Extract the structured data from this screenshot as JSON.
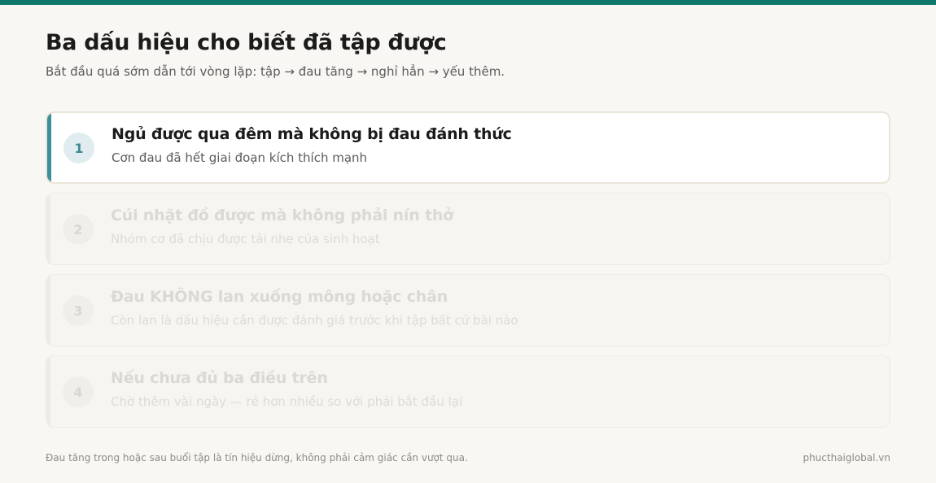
{
  "header": {
    "title": "Ba dấu hiệu cho biết đã tập được",
    "subtitle": "Bắt đầu quá sớm dẫn tới vòng lặp: tập → đau tăng → nghỉ hẳn → yếu thêm."
  },
  "steps": [
    {
      "number": "1",
      "title": "Ngủ được qua đêm mà không bị đau đánh thức",
      "description": "Cơn đau đã hết giai đoạn kích thích mạnh",
      "active": true
    },
    {
      "number": "2",
      "title": "Cúi nhặt đồ được mà không phải nín thở",
      "description": "Nhóm cơ đã chịu được tải nhẹ của sinh hoạt",
      "active": false
    },
    {
      "number": "3",
      "title": "Đau KHÔNG lan xuống mông hoặc chân",
      "description": "Còn lan là dấu hiệu cần được đánh giá trước khi tập bất cứ bài nào",
      "active": false
    },
    {
      "number": "4",
      "title": "Nếu chưa đủ ba điều trên",
      "description": "Chờ thêm vài ngày — rẻ hơn nhiều so với phải bắt đầu lại",
      "active": false
    }
  ],
  "footer": {
    "note": "Đau tăng trong hoặc sau buổi tập là tín hiệu dừng, không phải cảm giác cần vượt qua.",
    "site": "phucthaiglobal.vn"
  },
  "colors": {
    "accent": "#11776c",
    "active_marker": "#3d8f99",
    "background": "#f9f7f3"
  }
}
